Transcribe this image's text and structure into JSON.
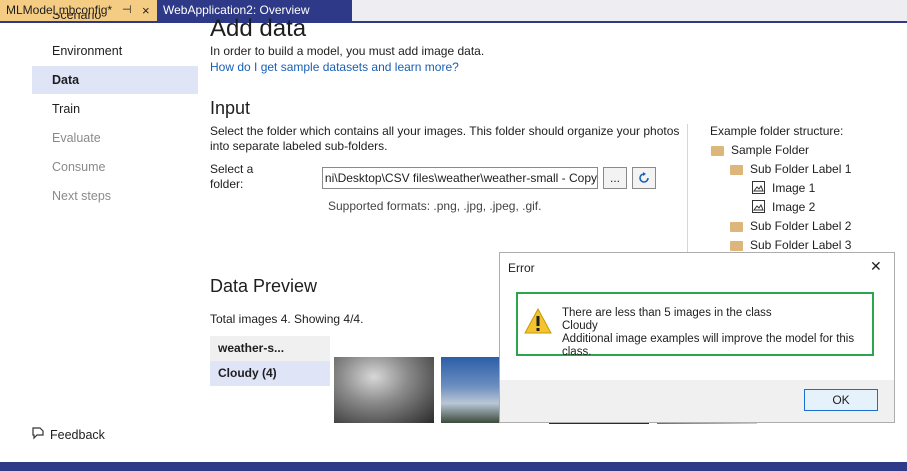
{
  "tabs": [
    {
      "label": "MLModel.mbconfig*",
      "pin": "⊣",
      "close": "×"
    },
    {
      "label": "WebApplication2: Overview"
    }
  ],
  "sidebar": {
    "items": [
      {
        "label": "Scenario"
      },
      {
        "label": "Environment"
      },
      {
        "label": "Data"
      },
      {
        "label": "Train"
      },
      {
        "label": "Evaluate"
      },
      {
        "label": "Consume"
      },
      {
        "label": "Next steps"
      }
    ],
    "feedback": "Feedback"
  },
  "main": {
    "title": "Add data",
    "intro": "In order to build a model, you must add image data.",
    "help_link": "How do I get sample datasets and learn more?",
    "input": {
      "heading": "Input",
      "description_line1": "Select the folder which contains all your images. This folder should organize your photos",
      "description_line2": "into separate labeled sub-folders.",
      "select_label_line1": "Select a",
      "select_label_line2": "folder:",
      "folder_value": "ni\\Desktop\\CSV files\\weather\\weather-small - Copy",
      "browse_label": "...",
      "supported": "Supported formats: .png, .jpg, .jpeg, .gif."
    },
    "example": {
      "heading": "Example folder structure:",
      "sample_folder": "Sample Folder",
      "sub1": "Sub Folder Label 1",
      "image1": "Image 1",
      "image2": "Image 2",
      "sub2": "Sub Folder Label 2",
      "sub3": "Sub Folder Label 3"
    },
    "preview": {
      "heading": "Data Preview",
      "summary": "Total images 4. Showing 4/4.",
      "dataset": "weather-s...",
      "class_label": "Cloudy (4)"
    }
  },
  "dialog": {
    "title": "Error",
    "close": "✕",
    "message_line1": "There are less than 5 images in the class",
    "message_line2": "Cloudy",
    "message_line3": "Additional image examples will improve the model for this",
    "message_line4": "class.",
    "ok": "OK"
  },
  "colors": {
    "accent": "#2e3a87",
    "tab_active": "#f5cc84",
    "nav_active": "#dfe4f7",
    "link": "#1a5fb4",
    "highlight_border": "#2da44e",
    "warning": "#f4c430"
  }
}
